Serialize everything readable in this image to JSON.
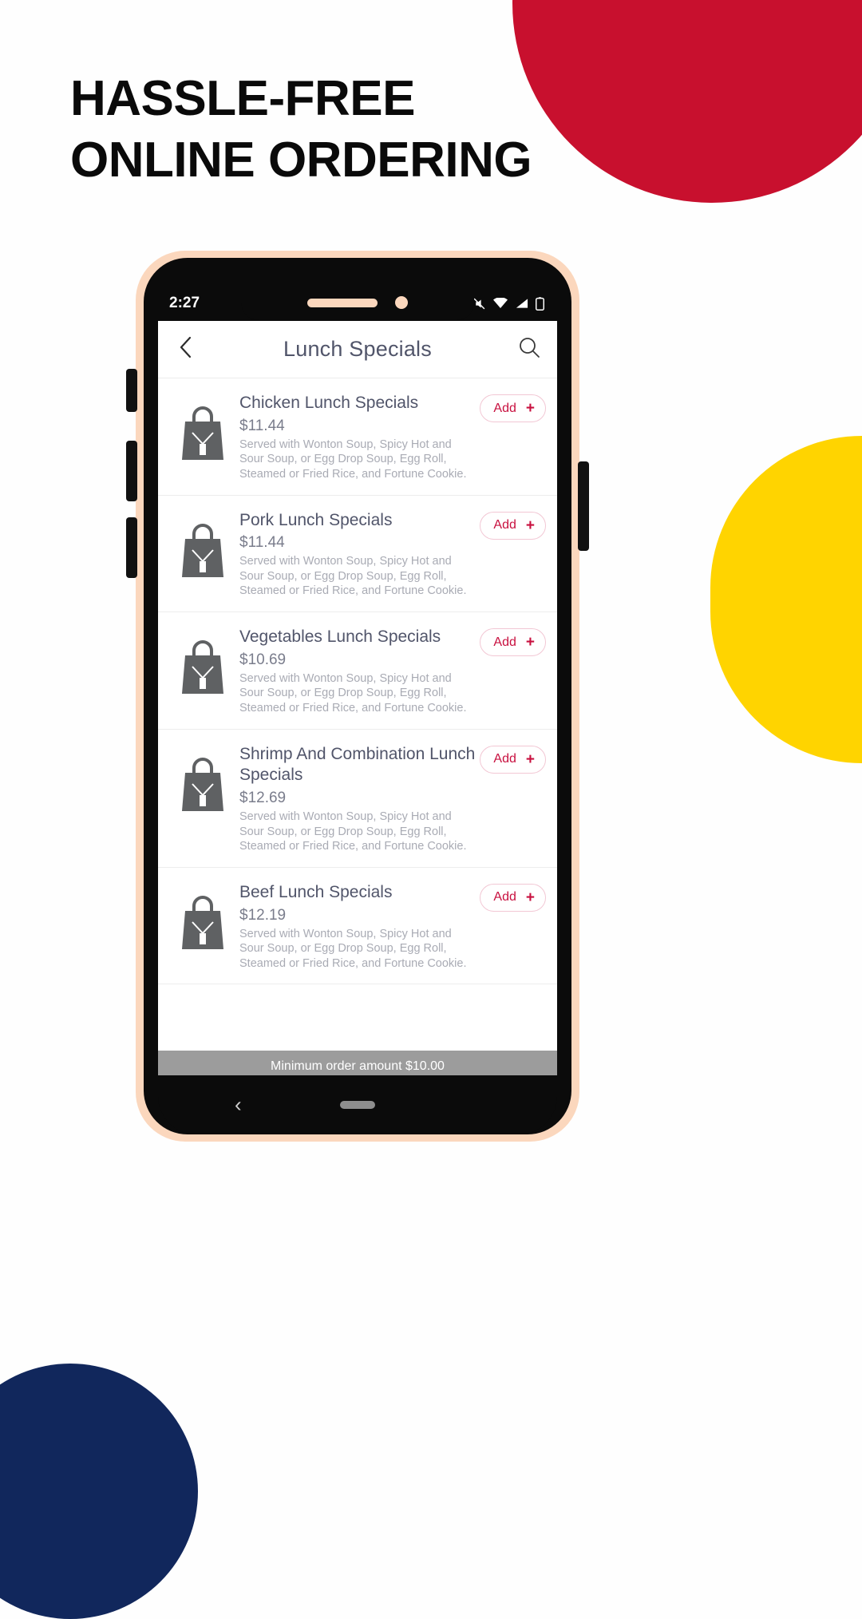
{
  "headline": {
    "line1": "HASSLE-FREE",
    "line2": "ONLINE ORDERING"
  },
  "colors": {
    "red": "#c8102e",
    "yellow": "#ffd400",
    "navy": "#11275c",
    "bezel": "#fbd7bd",
    "accent_pink": "#c8103f",
    "title_gray": "#51556a"
  },
  "phone": {
    "statusbar": {
      "time": "2:27",
      "icons": [
        "mute-icon",
        "wifi-icon",
        "signal-icon",
        "battery-icon"
      ]
    },
    "appbar": {
      "back_icon": "chevron-left-icon",
      "title": "Lunch Specials",
      "search_icon": "search-icon"
    },
    "menu": {
      "items": [
        {
          "name": "Chicken Lunch Specials",
          "price": "$11.44",
          "description": "Served with Wonton Soup, Spicy Hot and Sour Soup, or Egg Drop Soup, Egg Roll, Steamed or Fried Rice, and Fortune Cookie.",
          "add_label": "Add",
          "add_plus": "+"
        },
        {
          "name": "Pork Lunch Specials",
          "price": "$11.44",
          "description": "Served with Wonton Soup, Spicy Hot and Sour Soup, or Egg Drop Soup, Egg Roll, Steamed or Fried Rice, and Fortune Cookie.",
          "add_label": "Add",
          "add_plus": "+"
        },
        {
          "name": "Vegetables Lunch Specials",
          "price": "$10.69",
          "description": "Served with Wonton Soup, Spicy Hot and Sour Soup, or Egg Drop Soup, Egg Roll, Steamed or Fried Rice, and Fortune Cookie.",
          "add_label": "Add",
          "add_plus": "+"
        },
        {
          "name": "Shrimp And Combination Lunch Specials",
          "price": "$12.69",
          "description": "Served with Wonton Soup, Spicy Hot and Sour Soup, or Egg Drop Soup, Egg Roll, Steamed or Fried Rice, and Fortune Cookie.",
          "add_label": "Add",
          "add_plus": "+"
        },
        {
          "name": "Beef Lunch Specials",
          "price": "$12.19",
          "description": "Served with Wonton Soup, Spicy Hot and Sour Soup, or Egg Drop Soup, Egg Roll, Steamed or Fried Rice, and Fortune Cookie.",
          "add_label": "Add",
          "add_plus": "+"
        }
      ]
    },
    "minimum_order": "Minimum order amount $10.00",
    "navbar": {
      "back_icon": "nav-back-icon",
      "home_pill": "nav-home-pill"
    }
  }
}
